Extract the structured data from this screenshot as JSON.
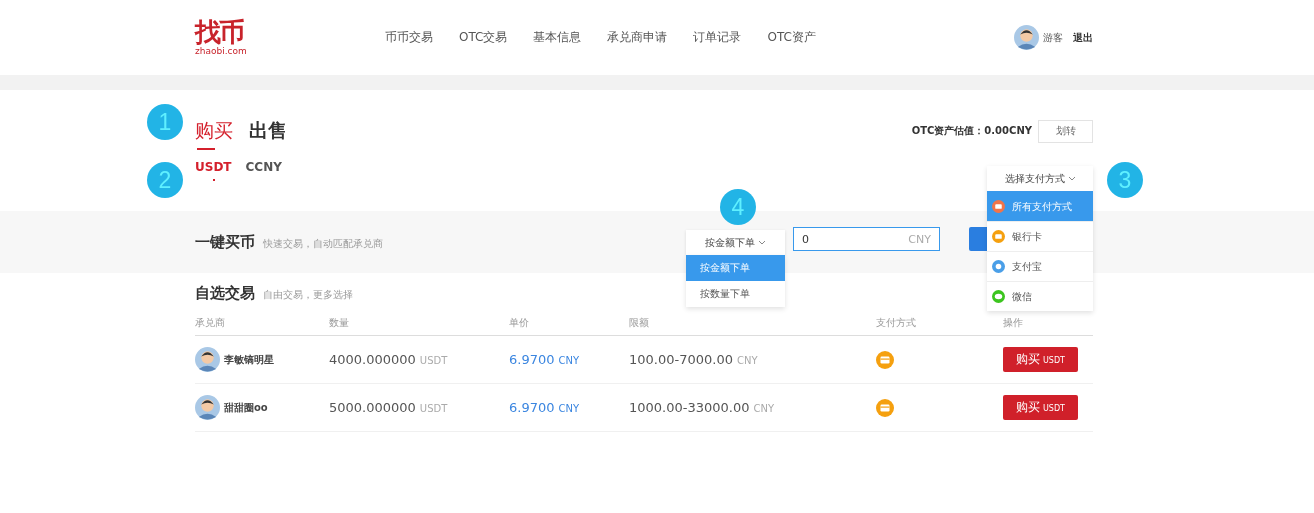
{
  "header": {
    "logo": {
      "mark": "找币",
      "domain": "zhaobi.com"
    },
    "nav": [
      "币币交易",
      "OTC交易",
      "基本信息",
      "承兑商申请",
      "订单记录",
      "OTC资产"
    ],
    "user": {
      "name": "游客",
      "logout": "退出"
    }
  },
  "trade_tabs": [
    {
      "label": "购买",
      "selected": true
    },
    {
      "label": "出售",
      "selected": false
    }
  ],
  "coin_tabs": [
    {
      "label": "USDT",
      "selected": true
    },
    {
      "label": "CCNY",
      "selected": false
    }
  ],
  "asset": {
    "label": "OTC资产估值：0.00CNY",
    "button": "划转"
  },
  "quick_buy": {
    "title": "一键买币",
    "subtitle": "快速交易，自动匹配承兑商",
    "mode_dropdown": {
      "label": "按金额下单",
      "options": [
        {
          "label": "按金额下单",
          "selected": true
        },
        {
          "label": "按数量下单",
          "selected": false
        }
      ]
    },
    "amount_input": {
      "value": "0",
      "unit": "CNY"
    }
  },
  "payment_dropdown": {
    "label": "选择支付方式",
    "options": [
      {
        "label": "所有支付方式",
        "kind": "all",
        "selected": true
      },
      {
        "label": "银行卡",
        "kind": "bank",
        "selected": false
      },
      {
        "label": "支付宝",
        "kind": "alipay",
        "selected": false
      },
      {
        "label": "微信",
        "kind": "wechat",
        "selected": false
      }
    ]
  },
  "custom_trade": {
    "title": "自选交易",
    "subtitle": "自由交易，更多选择"
  },
  "table": {
    "columns": [
      "承兑商",
      "数量",
      "单价",
      "限额",
      "支付方式",
      "操作"
    ],
    "rows": [
      {
        "merchant": "李敏镐明星",
        "quantity": "4000.000000",
        "quantity_unit": "USDT",
        "price": "6.9700",
        "price_unit": "CNY",
        "limit": "100.00-7000.00",
        "limit_unit": "CNY",
        "action": "购买",
        "action_unit": "USDT"
      },
      {
        "merchant": "甜甜圈oo",
        "quantity": "5000.000000",
        "quantity_unit": "USDT",
        "price": "6.9700",
        "price_unit": "CNY",
        "limit": "1000.00-33000.00",
        "limit_unit": "CNY",
        "action": "购买",
        "action_unit": "USDT"
      }
    ]
  },
  "callouts": [
    "1",
    "2",
    "3",
    "4"
  ]
}
